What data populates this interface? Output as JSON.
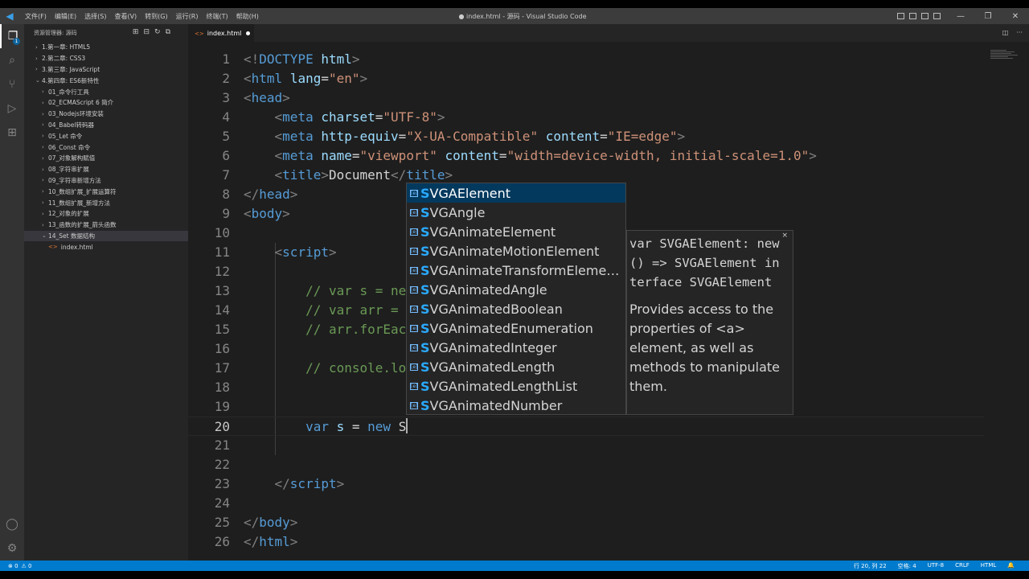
{
  "window": {
    "title": "● index.html - 源码 - Visual Studio Code",
    "menu": [
      "文件(F)",
      "编辑(E)",
      "选择(S)",
      "查看(V)",
      "转到(G)",
      "运行(R)",
      "终端(T)",
      "帮助(H)"
    ],
    "controls": [
      "—",
      "❐",
      "✕"
    ]
  },
  "activity_bar": {
    "items": [
      "explorer-icon",
      "search-icon",
      "source-control-icon",
      "run-debug-icon",
      "extensions-icon"
    ],
    "bottom": [
      "account-icon",
      "settings-gear-icon"
    ],
    "badge": "1"
  },
  "sidebar": {
    "header": "资源管理器: 源码",
    "tree": [
      {
        "label": "1.第一章: HTML5",
        "depth": 0,
        "state": "collapsed"
      },
      {
        "label": "2.第二章: CSS3",
        "depth": 0,
        "state": "collapsed"
      },
      {
        "label": "3.第三章: JavaScript",
        "depth": 0,
        "state": "collapsed"
      },
      {
        "label": "4.第四章: ES6新特性",
        "depth": 0,
        "state": "expanded"
      },
      {
        "label": "01_命令行工具",
        "depth": 1,
        "state": "collapsed"
      },
      {
        "label": "02_ECMAScript 6 简介",
        "depth": 1,
        "state": "collapsed"
      },
      {
        "label": "03_Nodejs环境安装",
        "depth": 1,
        "state": "collapsed"
      },
      {
        "label": "04_Babel转码器",
        "depth": 1,
        "state": "collapsed"
      },
      {
        "label": "05_Let 命令",
        "depth": 1,
        "state": "collapsed"
      },
      {
        "label": "06_Const 命令",
        "depth": 1,
        "state": "collapsed"
      },
      {
        "label": "07_对象解构赋值",
        "depth": 1,
        "state": "collapsed"
      },
      {
        "label": "08_字符串扩展",
        "depth": 1,
        "state": "collapsed"
      },
      {
        "label": "09_字符串新增方法",
        "depth": 1,
        "state": "collapsed"
      },
      {
        "label": "10_数组扩展_扩展运算符",
        "depth": 1,
        "state": "collapsed"
      },
      {
        "label": "11_数组扩展_新增方法",
        "depth": 1,
        "state": "collapsed"
      },
      {
        "label": "12_对象的扩展",
        "depth": 1,
        "state": "collapsed"
      },
      {
        "label": "13_函数的扩展_箭头函数",
        "depth": 1,
        "state": "collapsed"
      },
      {
        "label": "14_Set 数据结构",
        "depth": 1,
        "state": "expanded",
        "selected": true
      },
      {
        "label": "index.html",
        "depth": 2,
        "state": "file"
      }
    ]
  },
  "tab": {
    "label": "index.html",
    "modified": true
  },
  "editor": {
    "current_line": "20",
    "lines": [
      {
        "n": "1",
        "tokens": [
          [
            "punc",
            "<!"
          ],
          [
            "tag",
            "DOCTYPE"
          ],
          [
            "text",
            " "
          ],
          [
            "attr",
            "html"
          ],
          [
            "punc",
            ">"
          ]
        ]
      },
      {
        "n": "2",
        "tokens": [
          [
            "punc",
            "<"
          ],
          [
            "tag",
            "html"
          ],
          [
            "text",
            " "
          ],
          [
            "attr",
            "lang"
          ],
          [
            "text",
            "="
          ],
          [
            "str",
            "\"en\""
          ],
          [
            "punc",
            ">"
          ]
        ]
      },
      {
        "n": "3",
        "tokens": [
          [
            "punc",
            "<"
          ],
          [
            "tag",
            "head"
          ],
          [
            "punc",
            ">"
          ]
        ]
      },
      {
        "n": "4",
        "tokens": [
          [
            "text",
            "    "
          ],
          [
            "punc",
            "<"
          ],
          [
            "tag",
            "meta"
          ],
          [
            "text",
            " "
          ],
          [
            "attr",
            "charset"
          ],
          [
            "text",
            "="
          ],
          [
            "str",
            "\"UTF-8\""
          ],
          [
            "punc",
            ">"
          ]
        ]
      },
      {
        "n": "5",
        "tokens": [
          [
            "text",
            "    "
          ],
          [
            "punc",
            "<"
          ],
          [
            "tag",
            "meta"
          ],
          [
            "text",
            " "
          ],
          [
            "attr",
            "http-equiv"
          ],
          [
            "text",
            "="
          ],
          [
            "str",
            "\"X-UA-Compatible\""
          ],
          [
            "text",
            " "
          ],
          [
            "attr",
            "content"
          ],
          [
            "text",
            "="
          ],
          [
            "str",
            "\"IE=edge\""
          ],
          [
            "punc",
            ">"
          ]
        ]
      },
      {
        "n": "6",
        "tokens": [
          [
            "text",
            "    "
          ],
          [
            "punc",
            "<"
          ],
          [
            "tag",
            "meta"
          ],
          [
            "text",
            " "
          ],
          [
            "attr",
            "name"
          ],
          [
            "text",
            "="
          ],
          [
            "str",
            "\"viewport\""
          ],
          [
            "text",
            " "
          ],
          [
            "attr",
            "content"
          ],
          [
            "text",
            "="
          ],
          [
            "str",
            "\"width=device-width, initial-scale=1.0\""
          ],
          [
            "punc",
            ">"
          ]
        ]
      },
      {
        "n": "7",
        "tokens": [
          [
            "text",
            "    "
          ],
          [
            "punc",
            "<"
          ],
          [
            "tag",
            "title"
          ],
          [
            "punc",
            ">"
          ],
          [
            "text",
            "Document"
          ],
          [
            "punc",
            "</"
          ],
          [
            "tag",
            "title"
          ],
          [
            "punc",
            ">"
          ]
        ]
      },
      {
        "n": "8",
        "tokens": [
          [
            "punc",
            "</"
          ],
          [
            "tag",
            "head"
          ],
          [
            "punc",
            ">"
          ]
        ]
      },
      {
        "n": "9",
        "tokens": [
          [
            "punc",
            "<"
          ],
          [
            "tag",
            "body"
          ],
          [
            "punc",
            ">"
          ]
        ]
      },
      {
        "n": "10",
        "tokens": []
      },
      {
        "n": "11",
        "tokens": [
          [
            "text",
            "    "
          ],
          [
            "punc",
            "<"
          ],
          [
            "tag",
            "script"
          ],
          [
            "punc",
            ">"
          ]
        ]
      },
      {
        "n": "12",
        "tokens": []
      },
      {
        "n": "13",
        "tokens": [
          [
            "text",
            "        "
          ],
          [
            "com",
            "// var s = ne"
          ]
        ]
      },
      {
        "n": "14",
        "tokens": [
          [
            "text",
            "        "
          ],
          [
            "com",
            "// var arr = "
          ]
        ]
      },
      {
        "n": "15",
        "tokens": [
          [
            "text",
            "        "
          ],
          [
            "com",
            "// arr.forEac"
          ]
        ]
      },
      {
        "n": "16",
        "tokens": []
      },
      {
        "n": "17",
        "tokens": [
          [
            "text",
            "        "
          ],
          [
            "com",
            "// console.lo"
          ]
        ]
      },
      {
        "n": "18",
        "tokens": []
      },
      {
        "n": "19",
        "tokens": []
      },
      {
        "n": "20",
        "tokens": [
          [
            "text",
            "        "
          ],
          [
            "kw",
            "var"
          ],
          [
            "text",
            " "
          ],
          [
            "var",
            "s"
          ],
          [
            "text",
            " = "
          ],
          [
            "kw",
            "new"
          ],
          [
            "text",
            " S"
          ]
        ],
        "caret": true
      },
      {
        "n": "21",
        "tokens": []
      },
      {
        "n": "22",
        "tokens": []
      },
      {
        "n": "23",
        "tokens": [
          [
            "text",
            "    "
          ],
          [
            "punc",
            "</"
          ],
          [
            "tag",
            "script"
          ],
          [
            "punc",
            ">"
          ]
        ]
      },
      {
        "n": "24",
        "tokens": []
      },
      {
        "n": "25",
        "tokens": [
          [
            "punc",
            "</"
          ],
          [
            "tag",
            "body"
          ],
          [
            "punc",
            ">"
          ]
        ]
      },
      {
        "n": "26",
        "tokens": [
          [
            "punc",
            "</"
          ],
          [
            "tag",
            "html"
          ],
          [
            "punc",
            ">"
          ]
        ]
      }
    ]
  },
  "suggest": {
    "match": "S",
    "items": [
      "SVGAElement",
      "SVGAngle",
      "SVGAnimateElement",
      "SVGAnimateMotionElement",
      "SVGAnimateTransformEleme…",
      "SVGAnimatedAngle",
      "SVGAnimatedBoolean",
      "SVGAnimatedEnumeration",
      "SVGAnimatedInteger",
      "SVGAnimatedLength",
      "SVGAnimatedLengthList",
      "SVGAnimatedNumber"
    ],
    "selected_index": 0
  },
  "details": {
    "signature": "var SVGAElement: new () => SVGAElement interface SVGAElement",
    "doc": "Provides access to the properties of <a> element, as well as methods to manipulate them.",
    "close": "×"
  },
  "status_bar": {
    "errors": "⊗ 0",
    "warnings": "⚠ 0",
    "position": "行 20, 列 22",
    "spaces": "空格: 4",
    "encoding": "UTF-8",
    "eol": "CRLF",
    "language": "HTML",
    "colors": {
      "background": "#007acc"
    }
  }
}
